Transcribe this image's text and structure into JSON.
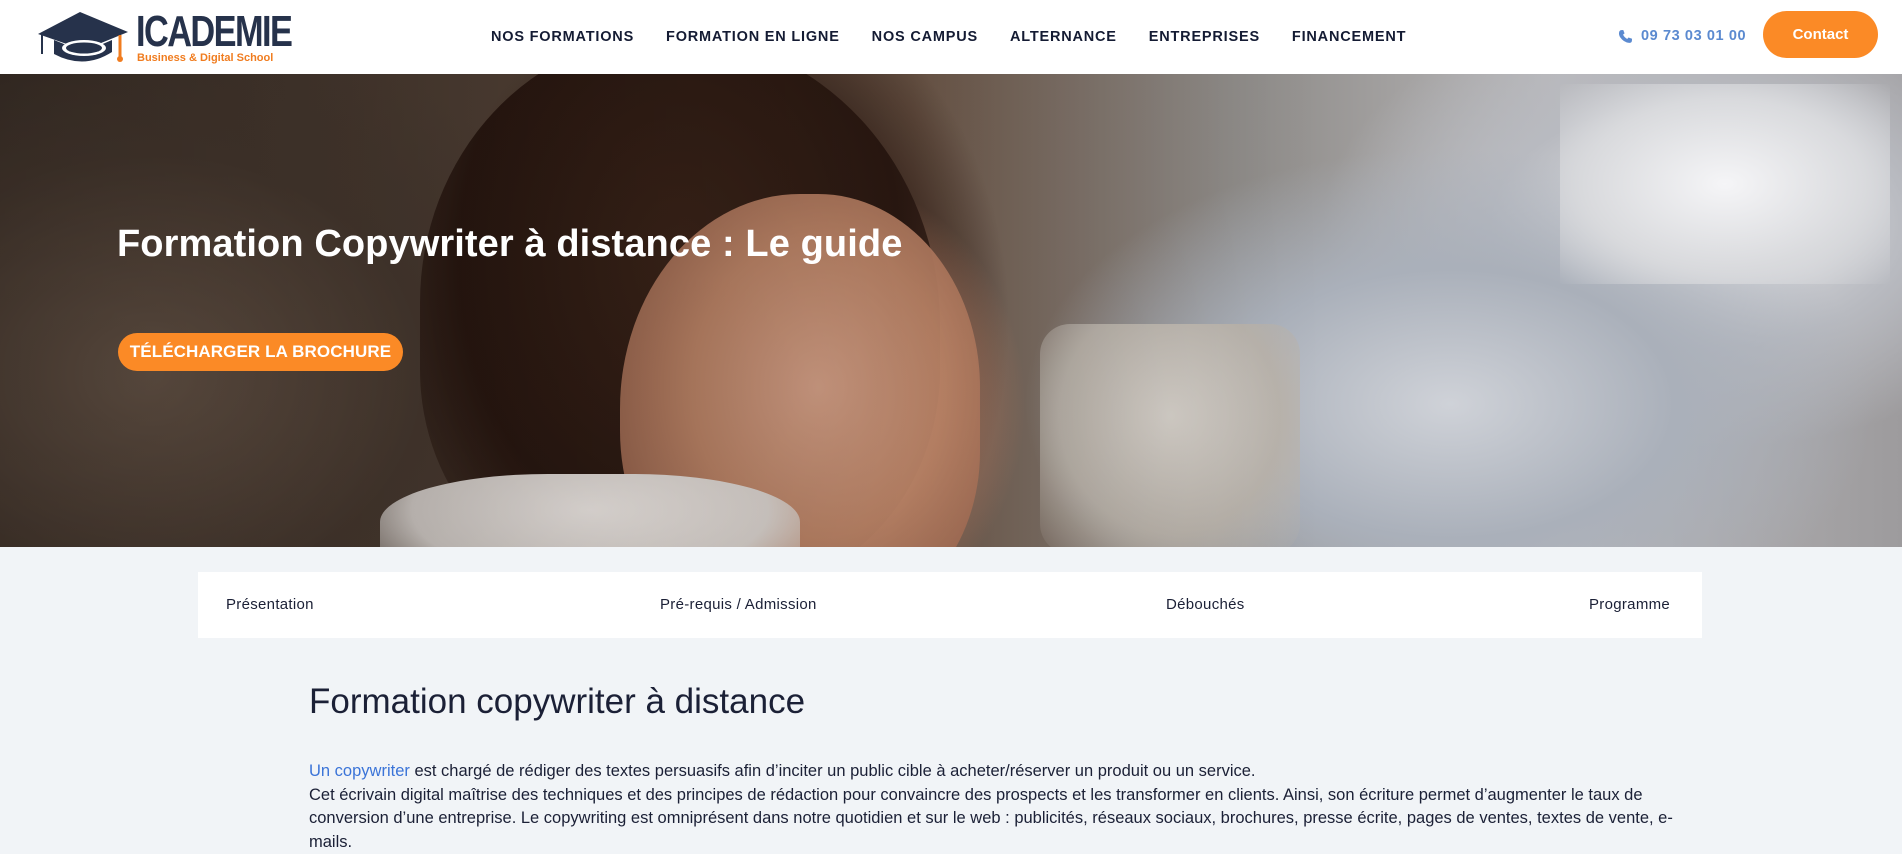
{
  "header": {
    "logo": {
      "name": "ICADEMIE",
      "tagline": "Business & Digital School"
    },
    "nav": [
      {
        "label": "NOS FORMATIONS"
      },
      {
        "label": "FORMATION EN LIGNE"
      },
      {
        "label": "NOS CAMPUS"
      },
      {
        "label": "ALTERNANCE"
      },
      {
        "label": "ENTREPRISES"
      },
      {
        "label": "FINANCEMENT"
      }
    ],
    "phone": "09 73 03 01 00",
    "contact_label": "Contact"
  },
  "hero": {
    "title": "Formation Copywriter à distance : Le guide",
    "cta_label": "TÉLÉCHARGER LA BROCHURE"
  },
  "tabs": [
    {
      "label": "Présentation"
    },
    {
      "label": "Pré-requis / Admission"
    },
    {
      "label": "Débouchés"
    },
    {
      "label": "Programme"
    }
  ],
  "content": {
    "title": "Formation copywriter à distance",
    "paragraph": {
      "link": "Un copywriter",
      "line1": " est chargé de rédiger des textes persuasifs afin d’inciter un public cible à acheter/réserver un produit ou un service.",
      "line2": "Cet écrivain digital maîtrise des techniques et des principes de rédaction pour convaincre des prospects et les transformer en clients. Ainsi, son écriture permet d’augmenter le taux de conversion d’une entreprise. Le copywriting est omniprésent dans notre quotidien et sur le web : publicités, réseaux sociaux, brochures, presse écrite, pages de ventes, textes de vente, e-mails."
    }
  },
  "colors": {
    "accent": "#fb8a26",
    "navy": "#26324b",
    "link": "#3b74d8",
    "phone": "#5b8ad0",
    "page_bg": "#f1f4f7"
  }
}
